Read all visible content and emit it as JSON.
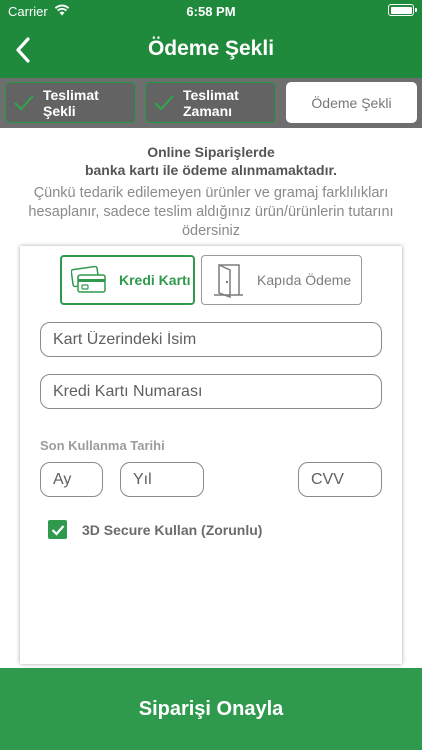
{
  "status_bar": {
    "carrier": "Carrier",
    "time": "6:58 PM"
  },
  "nav": {
    "title": "Ödeme Şekli"
  },
  "steps": [
    {
      "label": "Teslimat Şekli",
      "state": "done"
    },
    {
      "label": "Teslimat Zamanı",
      "state": "done"
    },
    {
      "label": "Ödeme Şekli",
      "state": "active"
    }
  ],
  "info": {
    "line1": "Online Siparişlerde",
    "line2": "banka kartı ile ödeme alınmamaktadır.",
    "note": "Çünkü tedarik edilemeyen ürünler ve gramaj farklılıkları hesaplanır, sadece teslim aldığınız ürün/ürünlerin tutarını ödersiniz"
  },
  "payment_methods": {
    "credit": "Kredi Kartı",
    "door": "Kapıda Ödeme",
    "selected": "credit"
  },
  "form": {
    "name_placeholder": "Kart Üzerindeki İsim",
    "number_placeholder": "Kredi Kartı Numarası",
    "expiry_label": "Son Kullanma Tarihi",
    "month_placeholder": "Ay",
    "year_placeholder": "Yıl",
    "cvv_placeholder": "CVV",
    "secure_label": "3D Secure Kullan (Zorunlu)",
    "secure_checked": true
  },
  "confirm_button": "Siparişi Onayla",
  "colors": {
    "primary": "#208a3c",
    "accent": "#2f9a4e",
    "step_bar": "#6e6e6e"
  }
}
